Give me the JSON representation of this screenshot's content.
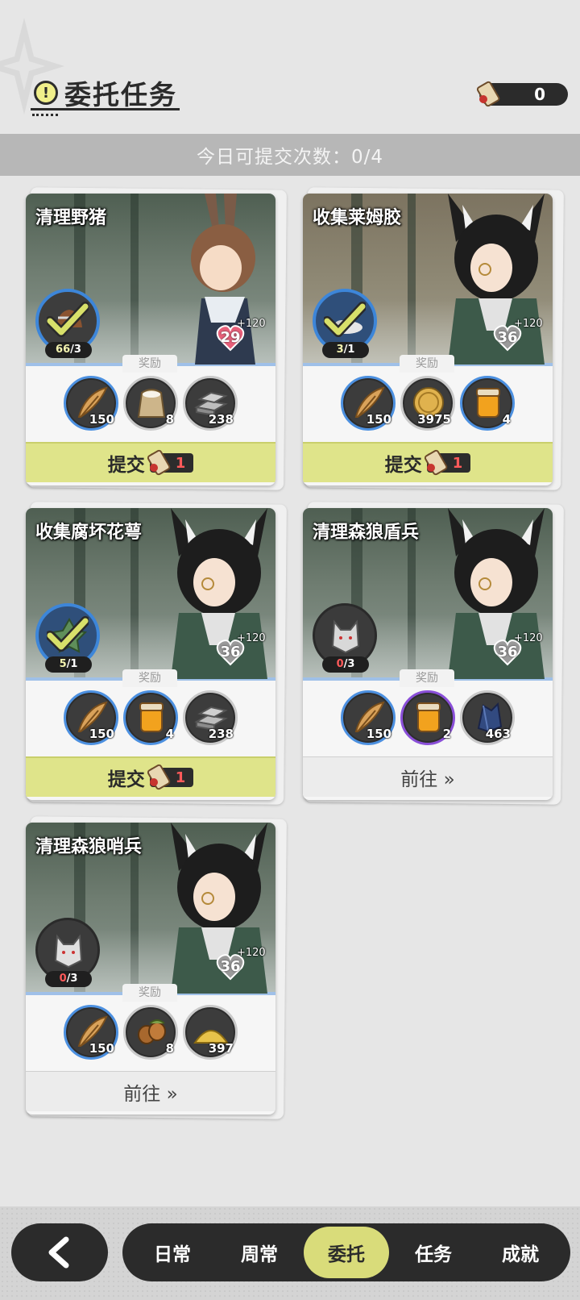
{
  "header": {
    "title": "委托任务",
    "scroll_count": "0"
  },
  "daily": {
    "text": "今日可提交次数：0/4"
  },
  "reward_label": "奖励",
  "quests": [
    {
      "name": "清理野猪",
      "affinity_level": "29",
      "affinity_bonus": "+120",
      "target_icon": "boar-icon",
      "progress_current": "66",
      "progress_total": "/3",
      "complete": true,
      "rewards": [
        {
          "icon": "feather-icon",
          "qty": "150"
        },
        {
          "icon": "flour-sack-icon",
          "qty": "8"
        },
        {
          "icon": "iron-ingot-icon",
          "qty": "238"
        }
      ],
      "action": {
        "type": "submit",
        "label": "提交",
        "cost": "1"
      }
    },
    {
      "name": "收集莱姆胶",
      "affinity_level": "36",
      "affinity_bonus": "+120",
      "target_icon": "lime-gel-icon",
      "progress_current": "3",
      "progress_total": "/1",
      "complete": true,
      "rewards": [
        {
          "icon": "feather-icon",
          "qty": "150"
        },
        {
          "icon": "gold-coin-icon",
          "qty": "3975"
        },
        {
          "icon": "honey-jar-icon",
          "qty": "4"
        }
      ],
      "action": {
        "type": "submit",
        "label": "提交",
        "cost": "1"
      }
    },
    {
      "name": "收集腐坏花萼",
      "affinity_level": "36",
      "affinity_bonus": "+120",
      "target_icon": "calyx-leaf-icon",
      "progress_current": "5",
      "progress_total": "/1",
      "complete": true,
      "rewards": [
        {
          "icon": "feather-icon",
          "qty": "150"
        },
        {
          "icon": "honey-jar-icon",
          "qty": "4"
        },
        {
          "icon": "iron-ingot-icon",
          "qty": "238"
        }
      ],
      "action": {
        "type": "submit",
        "label": "提交",
        "cost": "1"
      }
    },
    {
      "name": "清理森狼盾兵",
      "affinity_level": "36",
      "affinity_bonus": "+120",
      "target_icon": "wolf-shield-soldier-icon",
      "progress_current": "0",
      "progress_total": "/3",
      "complete": false,
      "rewards": [
        {
          "icon": "feather-icon",
          "qty": "150"
        },
        {
          "icon": "honey-jar-icon",
          "qty": "2"
        },
        {
          "icon": "dark-crystal-icon",
          "qty": "463"
        }
      ],
      "action": {
        "type": "go",
        "label": "前往 »"
      }
    },
    {
      "name": "清理森狼哨兵",
      "affinity_level": "36",
      "affinity_bonus": "+120",
      "target_icon": "wolf-sentry-icon",
      "progress_current": "0",
      "progress_total": "/3",
      "complete": false,
      "rewards": [
        {
          "icon": "feather-icon",
          "qty": "150"
        },
        {
          "icon": "hazelnut-icon",
          "qty": "8"
        },
        {
          "icon": "sand-pile-icon",
          "qty": "397"
        }
      ],
      "action": {
        "type": "go",
        "label": "前往 »"
      }
    }
  ],
  "nav": {
    "back_icon": "back-arrow-icon",
    "tabs": [
      "日常",
      "周常",
      "委托",
      "任务",
      "成就"
    ],
    "active": "委托"
  },
  "colors": {
    "accent": "#d9dc7a",
    "submit_band": "#dfe48a",
    "dark": "#2b2b2b",
    "progress_red": "#ff5a5a",
    "ring_blue": "#4c90e0"
  }
}
